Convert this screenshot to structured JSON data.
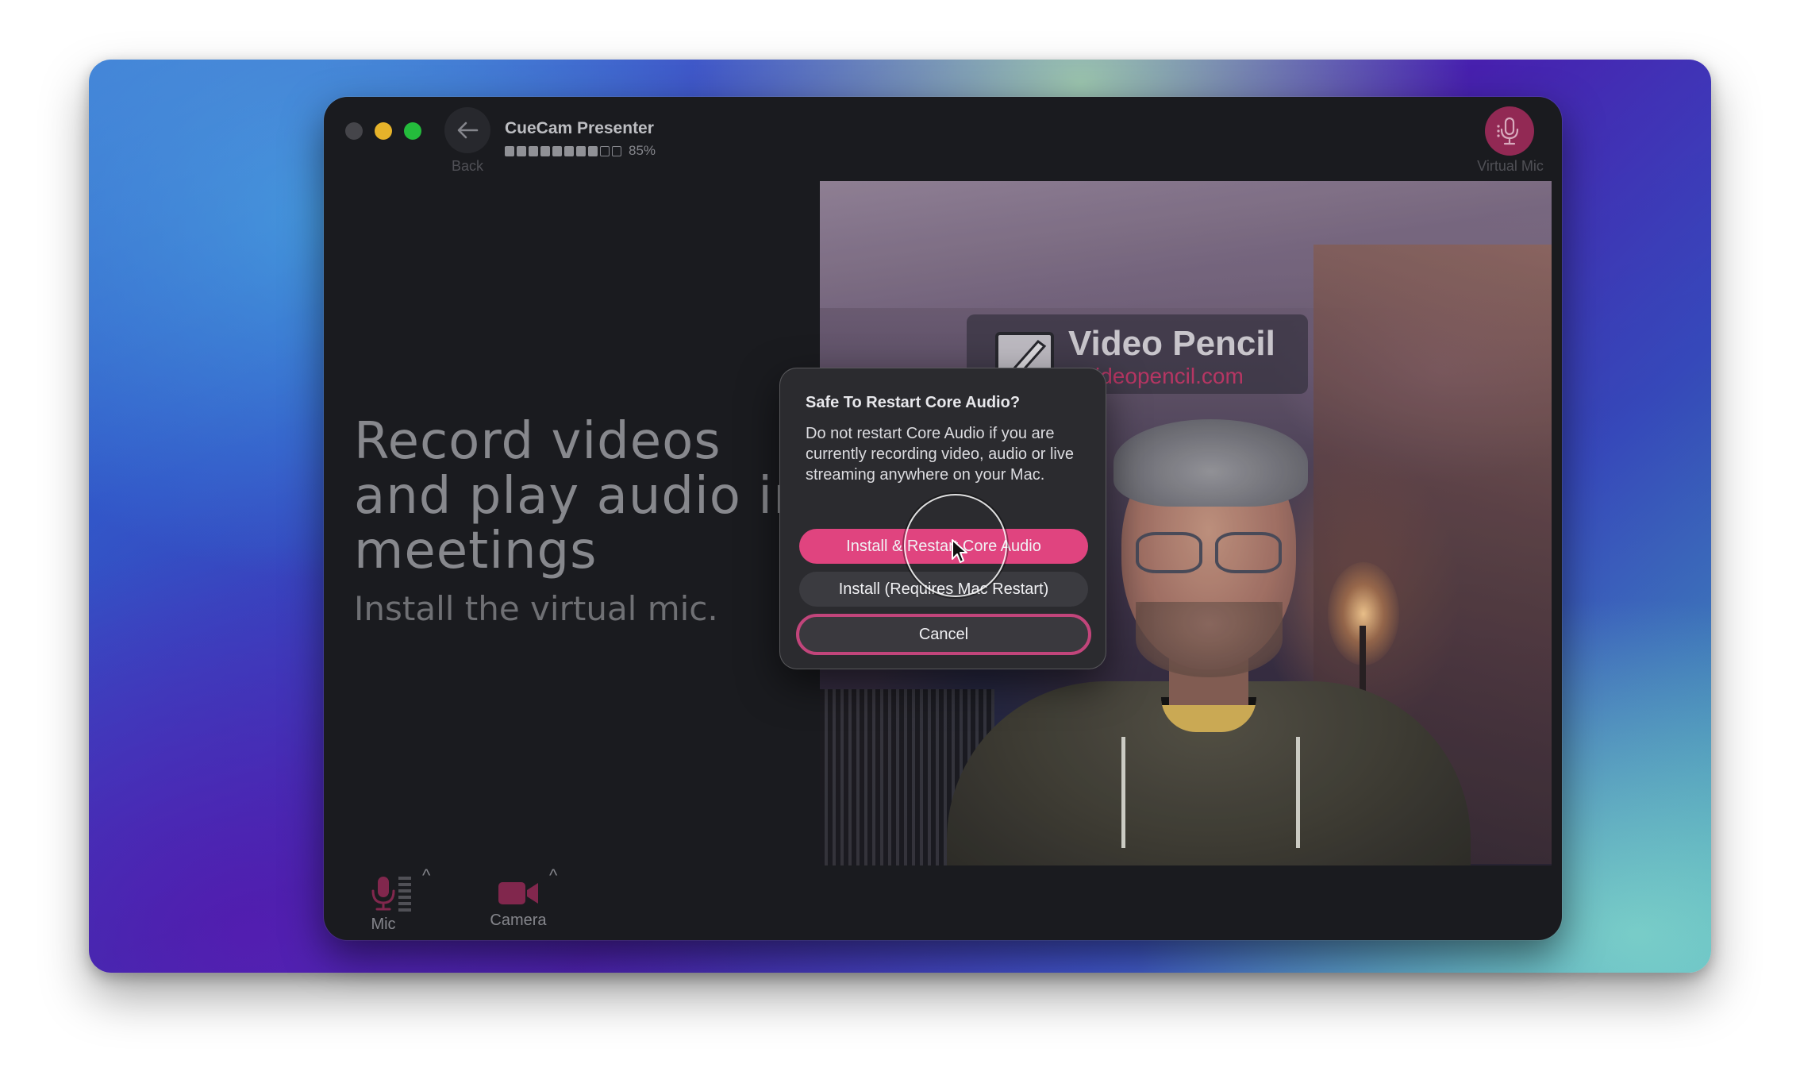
{
  "window": {
    "app_title": "CueCam Presenter",
    "back_label": "Back",
    "progress_percent": 85,
    "progress_filled_segments": 8,
    "progress_total_segments": 10,
    "progress_text": "85%",
    "virtual_mic_label": "Virtual Mic"
  },
  "main": {
    "headline_line1": "Record videos",
    "headline_line2": "and play audio in",
    "headline_line3": "meetings",
    "subline": "Install the virtual mic."
  },
  "video_preview": {
    "logo_title": "Video Pencil",
    "logo_url": "videopencil.com"
  },
  "toolbar": {
    "mic_label": "Mic",
    "camera_label": "Camera"
  },
  "dialog": {
    "title": "Safe To Restart Core Audio?",
    "body": "Do not restart Core Audio if you are currently recording video, audio or live streaming anywhere on your Mac.",
    "primary_button": "Install & Restart Core Audio",
    "secondary_button": "Install (Requires Mac Restart)",
    "cancel_button": "Cancel"
  },
  "colors": {
    "accent": "#e0447f",
    "virtual_mic_bg": "#9c2c5a",
    "window_bg": "#1c1d21",
    "dialog_bg": "#2b2b2f"
  },
  "icons": {
    "back": "arrow-left-icon",
    "virtual_mic": "microphone-icon",
    "mic": "microphone-icon",
    "camera": "video-camera-icon"
  }
}
